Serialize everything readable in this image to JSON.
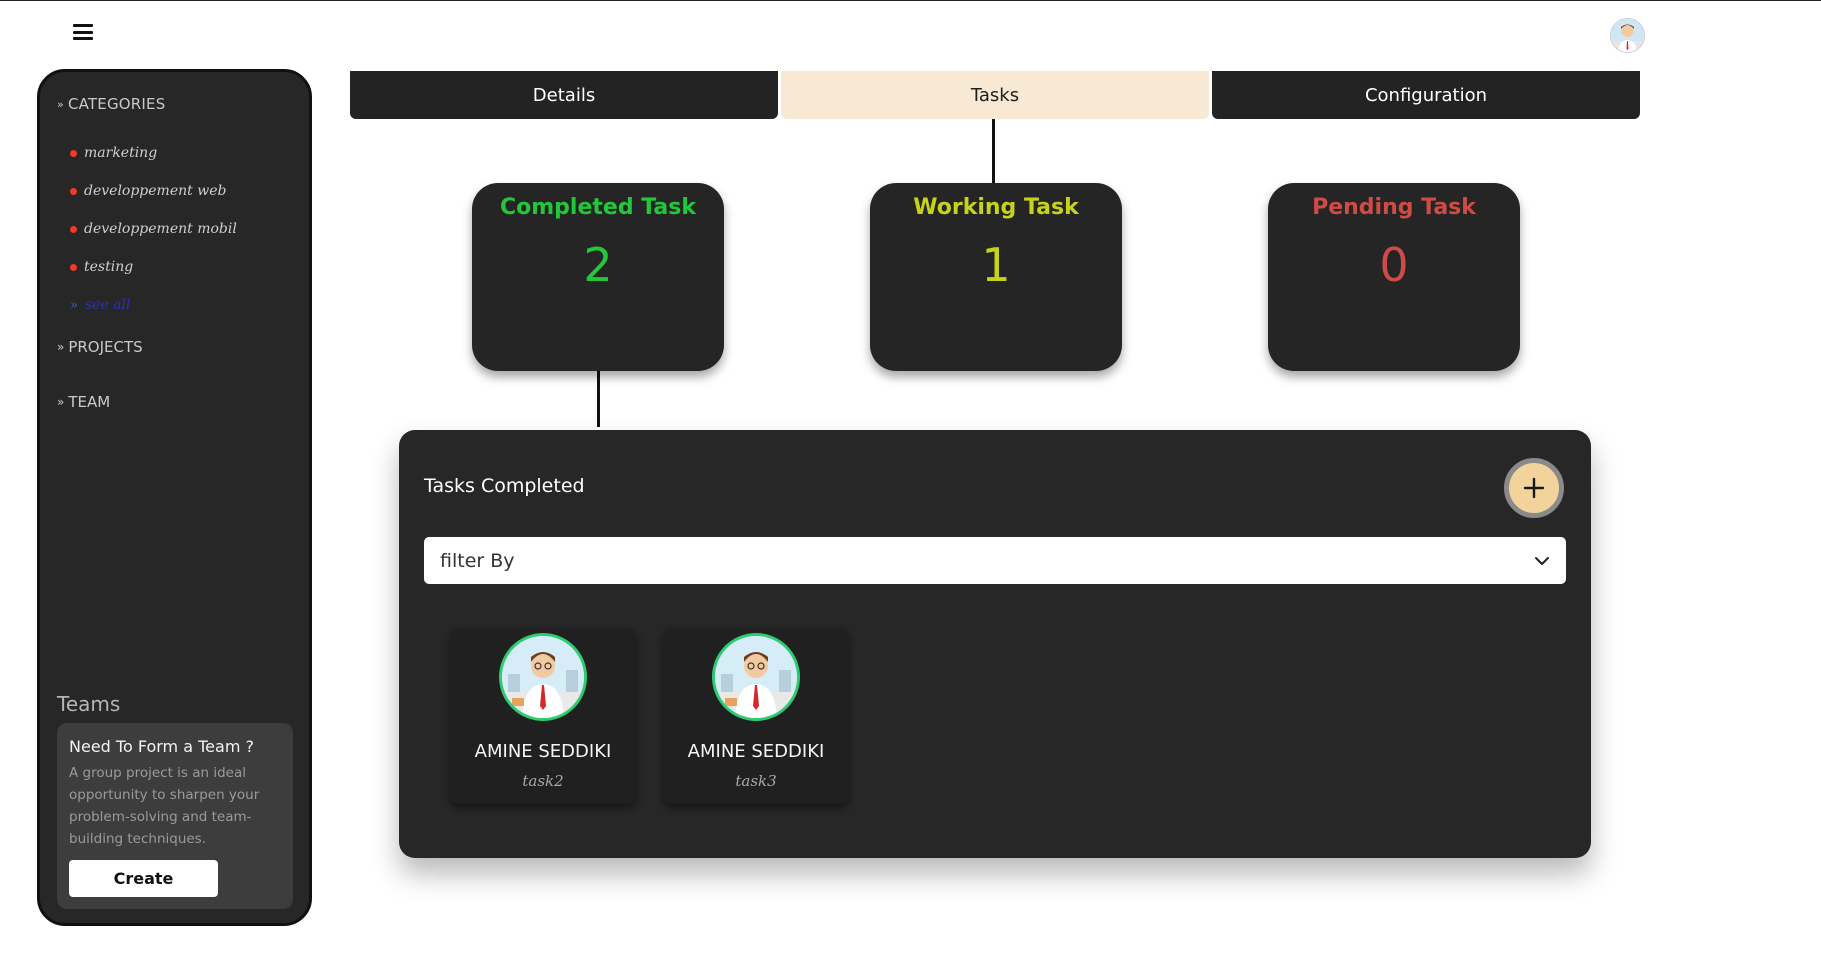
{
  "sidebar": {
    "categories_label": "CATEGORIES",
    "categories": [
      {
        "label": "marketing"
      },
      {
        "label": "developpement web"
      },
      {
        "label": "developpement mobil"
      },
      {
        "label": "testing"
      }
    ],
    "see_all_label": "see all",
    "projects_label": "PROJECTS",
    "team_label": "TEAM",
    "teams_title": "Teams",
    "team_card": {
      "title": "Need To Form a Team ?",
      "text": "A group project is an ideal opportunity to sharpen your problem-solving and team-building techniques.",
      "button_label": "Create"
    }
  },
  "tabs": [
    {
      "label": "Details",
      "active": false
    },
    {
      "label": "Tasks",
      "active": true
    },
    {
      "label": "Configuration",
      "active": false
    }
  ],
  "stats": [
    {
      "label": "Completed Task",
      "value": "2",
      "color": "#22c83a"
    },
    {
      "label": "Working Task",
      "value": "1",
      "color": "#c7d21b"
    },
    {
      "label": "Pending Task",
      "value": "0",
      "color": "#cf4b45"
    }
  ],
  "panel": {
    "title": "Tasks Completed",
    "add_icon": "plus-icon",
    "filter_placeholder": "filter By",
    "tasks": [
      {
        "name": "AMINE SEDDIKI",
        "task": "task2"
      },
      {
        "name": "AMINE SEDDIKI",
        "task": "task3"
      }
    ]
  },
  "colors": {
    "accent_cream": "#f7e9d4",
    "dark_surface": "#272727",
    "category_dot": "#ef3b2a",
    "avatar_ring": "#2ecc71"
  }
}
